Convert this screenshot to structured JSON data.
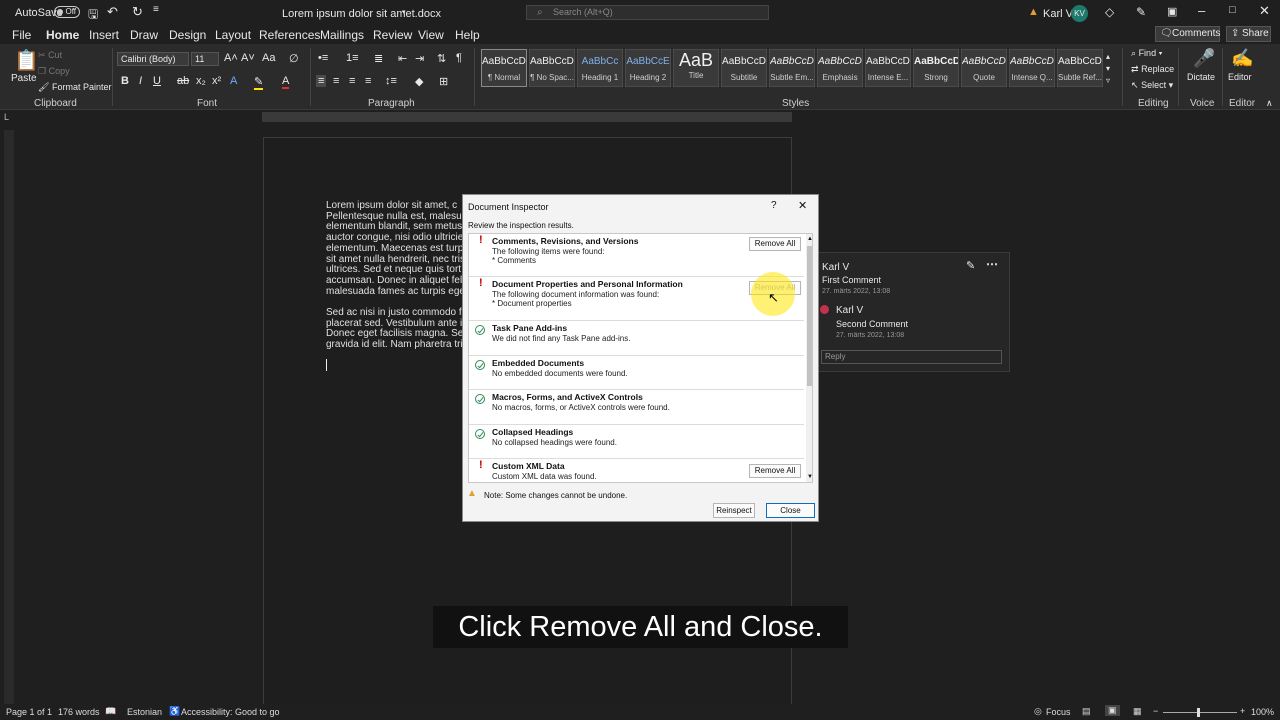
{
  "titlebar": {
    "autosave_label": "AutoSave",
    "autosave_state": "Off",
    "doc_title": "Lorem ipsum dolor sit amet.docx",
    "search_placeholder": "Search (Alt+Q)",
    "user_name": "Karl V",
    "user_initials": "KV"
  },
  "tabs": [
    "File",
    "Home",
    "Insert",
    "Draw",
    "Design",
    "Layout",
    "References",
    "Mailings",
    "Review",
    "View",
    "Help"
  ],
  "active_tab": "Home",
  "ribbon_right": {
    "comments": "Comments",
    "share": "Share"
  },
  "ribbon": {
    "clipboard": {
      "paste": "Paste",
      "cut": "Cut",
      "copy": "Copy",
      "format_painter": "Format Painter",
      "label": "Clipboard"
    },
    "font": {
      "name": "Calibri (Body)",
      "size": "11",
      "label": "Font"
    },
    "paragraph": {
      "label": "Paragraph"
    },
    "styles": {
      "label": "Styles",
      "items": [
        {
          "sample": "AaBbCcDc",
          "name": "¶ Normal"
        },
        {
          "sample": "AaBbCcDc",
          "name": "¶ No Spac..."
        },
        {
          "sample": "AaBbCc",
          "name": "Heading 1"
        },
        {
          "sample": "AaBbCcE",
          "name": "Heading 2"
        },
        {
          "sample": "AaB",
          "name": "Title"
        },
        {
          "sample": "AaBbCcD",
          "name": "Subtitle"
        },
        {
          "sample": "AaBbCcDc",
          "name": "Subtle Em..."
        },
        {
          "sample": "AaBbCcDc",
          "name": "Emphasis"
        },
        {
          "sample": "AaBbCcDc",
          "name": "Intense E..."
        },
        {
          "sample": "AaBbCcDc",
          "name": "Strong"
        },
        {
          "sample": "AaBbCcDc",
          "name": "Quote"
        },
        {
          "sample": "AaBbCcDc",
          "name": "Intense Q..."
        },
        {
          "sample": "AaBbCcDc",
          "name": "Subtle Ref..."
        }
      ]
    },
    "editing": {
      "find": "Find",
      "replace": "Replace",
      "select": "Select",
      "label": "Editing"
    },
    "voice": {
      "dictate": "Dictate",
      "label": "Voice"
    },
    "editor": {
      "editor": "Editor",
      "label": "Editor"
    }
  },
  "document": {
    "lines": [
      "Lorem ipsum dolor sit amet, c",
      "Pellentesque nulla est, malesuad",
      "elementum blandit, sem metus ia",
      "auctor congue, nisi odio ultricies",
      "elementum. Maecenas est turpis",
      "sit amet nulla hendrerit, nec tris",
      "ultrices. Sed et neque quis tort",
      "accumsan. Donec in aliquet fel",
      "malesuada fames ac turpis egest",
      "",
      "Sed ac nisi in justo commodo fe",
      "placerat sed. Vestibulum ante ips",
      "Donec eget facilisis magna. Sed",
      "gravida id elit. Nam pharetra tristi"
    ]
  },
  "comments": {
    "first": {
      "author": "Karl V",
      "text": "First Comment",
      "date": "27. märts 2022, 13:08"
    },
    "second": {
      "author": "Karl V",
      "text": "Second Comment",
      "date": "27. märts 2022, 13:08"
    },
    "reply_placeholder": "Reply"
  },
  "dialog": {
    "title": "Document Inspector",
    "help": "?",
    "subtitle": "Review the inspection results.",
    "rows": [
      {
        "status": "warn",
        "title": "Comments, Revisions, and Versions",
        "desc": "The following items were found:",
        "item": "* Comments",
        "button": "Remove All"
      },
      {
        "status": "warn",
        "title": "Document Properties and Personal Information",
        "desc": "The following document information was found:",
        "item": "* Document properties",
        "button": "Remove All"
      },
      {
        "status": "ok",
        "title": "Task Pane Add-ins",
        "desc": "We did not find any Task Pane add-ins.",
        "item": "",
        "button": ""
      },
      {
        "status": "ok",
        "title": "Embedded Documents",
        "desc": "No embedded documents were found.",
        "item": "",
        "button": ""
      },
      {
        "status": "ok",
        "title": "Macros, Forms, and ActiveX Controls",
        "desc": "No macros, forms, or ActiveX controls were found.",
        "item": "",
        "button": ""
      },
      {
        "status": "ok",
        "title": "Collapsed Headings",
        "desc": "No collapsed headings were found.",
        "item": "",
        "button": ""
      },
      {
        "status": "warn",
        "title": "Custom XML Data",
        "desc": "Custom XML data was found.",
        "item": "",
        "button": "Remove All"
      }
    ],
    "note": "Note: Some changes cannot be undone.",
    "reinspect": "Reinspect",
    "close": "Close"
  },
  "statusbar": {
    "page": "Page 1 of 1",
    "words": "176 words",
    "language": "Estonian",
    "accessibility": "Accessibility: Good to go",
    "focus": "Focus",
    "zoom": "100%"
  },
  "caption": "Click Remove All and Close.",
  "colors": {
    "accent": "#0f6cbd",
    "warning": "#c40000",
    "ok": "#2e8b57",
    "cursor_highlight": "#ffe600"
  }
}
